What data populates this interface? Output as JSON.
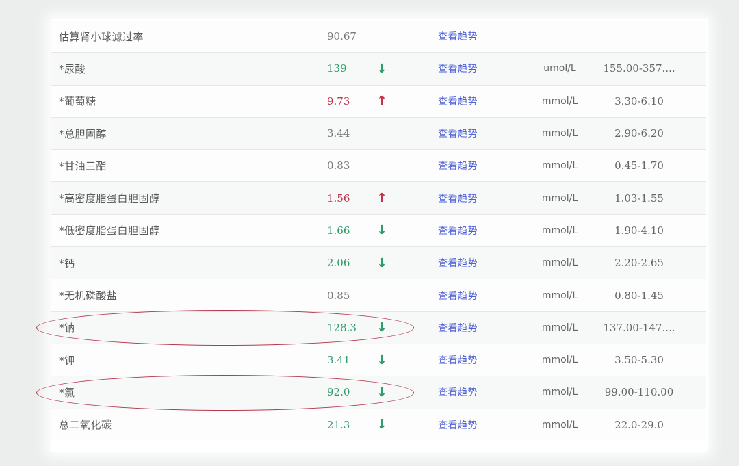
{
  "table": {
    "link_label": "查看趋势",
    "rows": [
      {
        "name": "估算肾小球滤过率",
        "value": "90.67",
        "flag": "",
        "arrow": "",
        "unit": "",
        "range": ""
      },
      {
        "name": "*尿酸",
        "value": "139",
        "flag": "low",
        "arrow": "↓",
        "unit": "umol/L",
        "range": "155.00-357...."
      },
      {
        "name": "*葡萄糖",
        "value": "9.73",
        "flag": "high",
        "arrow": "↑",
        "unit": "mmol/L",
        "range": "3.30-6.10"
      },
      {
        "name": "*总胆固醇",
        "value": "3.44",
        "flag": "",
        "arrow": "",
        "unit": "mmol/L",
        "range": "2.90-6.20"
      },
      {
        "name": "*甘油三酯",
        "value": "0.83",
        "flag": "",
        "arrow": "",
        "unit": "mmol/L",
        "range": "0.45-1.70"
      },
      {
        "name": "*高密度脂蛋白胆固醇",
        "value": "1.56",
        "flag": "high",
        "arrow": "↑",
        "unit": "mmol/L",
        "range": "1.03-1.55"
      },
      {
        "name": "*低密度脂蛋白胆固醇",
        "value": "1.66",
        "flag": "low",
        "arrow": "↓",
        "unit": "mmol/L",
        "range": "1.90-4.10"
      },
      {
        "name": "*钙",
        "value": "2.06",
        "flag": "low",
        "arrow": "↓",
        "unit": "mmol/L",
        "range": "2.20-2.65"
      },
      {
        "name": "*无机磷酸盐",
        "value": "0.85",
        "flag": "",
        "arrow": "",
        "unit": "mmol/L",
        "range": "0.80-1.45"
      },
      {
        "name": "*钠",
        "value": "128.3",
        "flag": "low",
        "arrow": "↓",
        "unit": "mmol/L",
        "range": "137.00-147...."
      },
      {
        "name": "*钾",
        "value": "3.41",
        "flag": "low",
        "arrow": "↓",
        "unit": "mmol/L",
        "range": "3.50-5.30"
      },
      {
        "name": "*氯",
        "value": "92.0",
        "flag": "low",
        "arrow": "↓",
        "unit": "mmol/L",
        "range": "99.00-110.00"
      },
      {
        "name": "总二氧化碳",
        "value": "21.3",
        "flag": "low",
        "arrow": "↓",
        "unit": "mmol/L",
        "range": "22.0-29.0"
      }
    ]
  },
  "annotations": {
    "color": "#b5354a",
    "circled_rows": [
      9,
      11
    ]
  }
}
